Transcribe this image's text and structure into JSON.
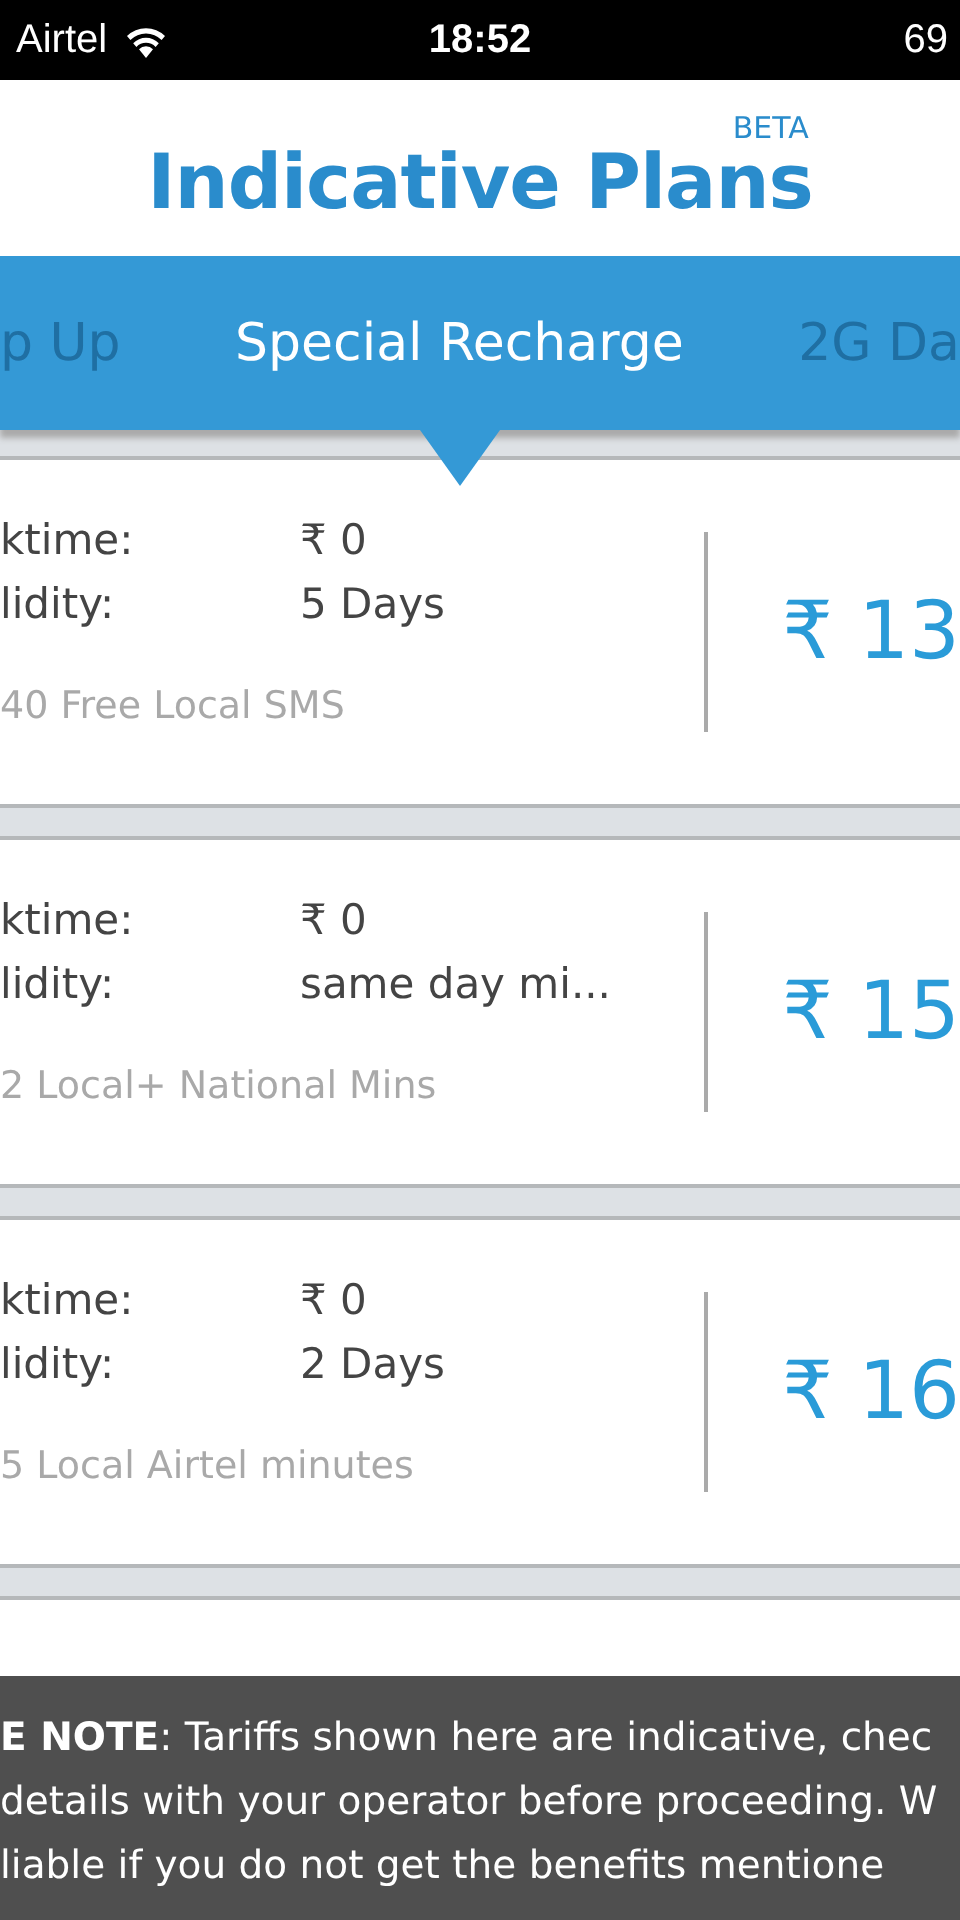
{
  "status_bar": {
    "carrier": "Airtel",
    "time": "18:52",
    "battery": "69"
  },
  "header": {
    "title": "Indicative Plans",
    "badge": "BETA"
  },
  "tabs": [
    {
      "label": "p Up",
      "selected": false
    },
    {
      "label": "Special Recharge",
      "selected": true
    },
    {
      "label": "2G Da",
      "selected": false
    }
  ],
  "plans": [
    {
      "talktime_label": "ktime:",
      "talktime": "₹ 0",
      "validity_label": "lidity:",
      "validity": "5 Days",
      "benefit": "40 Free Local SMS",
      "price": "₹ 13"
    },
    {
      "talktime_label": "ktime:",
      "talktime": "₹ 0",
      "validity_label": "lidity:",
      "validity": "same day mi...",
      "benefit": "2 Local+ National Mins",
      "price": "₹ 15"
    },
    {
      "talktime_label": "ktime:",
      "talktime": "₹ 0",
      "validity_label": "lidity:",
      "validity": "2 Days",
      "benefit": "5 Local Airtel minutes",
      "price": "₹ 16"
    }
  ],
  "note": {
    "lines": [
      "**E NOTE**: Tariffs shown here are indicative, chec",
      "details with your operator before proceeding. W",
      "liable if you do not get the benefits mentione"
    ]
  }
}
